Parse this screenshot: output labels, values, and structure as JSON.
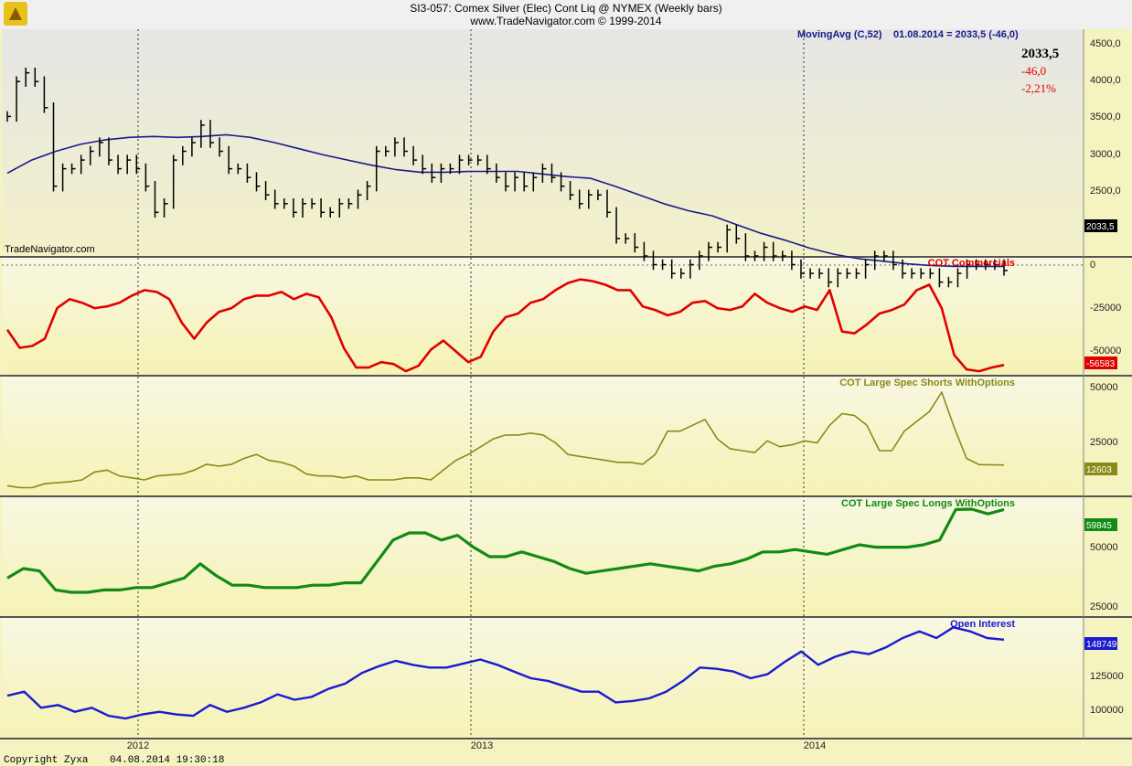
{
  "header": {
    "title": "SI3-057:  Comex Silver (Elec) Cont Liq @ NYMEX  (Weekly bars)",
    "subtitle": "www.TradeNavigator.com © 1999-2014",
    "watermark": "TradeNavigator.com",
    "footer_copyright": "Copyright Zyxa",
    "footer_timestamp": "04.08.2014 19:30:18"
  },
  "colors": {
    "price": "#000000",
    "ma": "#1a1a8c",
    "commercials": "#e00000",
    "shorts": "#8a8a1a",
    "longs": "#138a13",
    "oi": "#1a1ad0"
  },
  "chart_data": [
    {
      "type": "ohlc-bar",
      "panel": "price",
      "timeframe": "Weekly bars",
      "x_tick_labels": [
        "2012",
        "2013",
        "2014"
      ],
      "y_ticks": [
        "4500,0",
        "4000,0",
        "3500,0",
        "3000,0",
        "2500,0"
      ],
      "ylim": [
        2200,
        4800
      ],
      "overlay": {
        "name": "MovingAvg (C,52)",
        "readout": "01.08.2014 = 2033,5 (-46,0)",
        "values": [
          3150,
          3300,
          3400,
          3480,
          3530,
          3560,
          3570,
          3560,
          3570,
          3590,
          3560,
          3500,
          3430,
          3360,
          3300,
          3240,
          3190,
          3160,
          3160,
          3170,
          3170,
          3170,
          3140,
          3110,
          3090,
          3000,
          2900,
          2800,
          2720,
          2660,
          2560,
          2460,
          2380,
          2290,
          2220,
          2170,
          2140,
          2110,
          2090,
          2080,
          2080,
          2080
        ]
      },
      "values": [
        3800,
        4200,
        4300,
        4200,
        3900,
        3000,
        3200,
        3200,
        3300,
        3400,
        3500,
        3300,
        3200,
        3300,
        3200,
        3000,
        2700,
        2800,
        3300,
        3400,
        3500,
        3700,
        3500,
        3400,
        3200,
        3200,
        3100,
        3000,
        2900,
        2800,
        2800,
        2700,
        2800,
        2800,
        2700,
        2700,
        2800,
        2800,
        2900,
        3000,
        3400,
        3400,
        3500,
        3400,
        3300,
        3200,
        3100,
        3200,
        3200,
        3300,
        3300,
        3300,
        3200,
        3100,
        3000,
        3100,
        3000,
        3100,
        3200,
        3100,
        3000,
        2900,
        2800,
        2900,
        2900,
        2700,
        2400,
        2400,
        2300,
        2200,
        2100,
        2100,
        2000,
        2000,
        2100,
        2200,
        2300,
        2300,
        2500,
        2400,
        2200,
        2200,
        2300,
        2200,
        2200,
        2100,
        2000,
        2000,
        2000,
        1900,
        2000,
        2000,
        2000,
        2100,
        2200,
        2200,
        2100,
        2000,
        2000,
        2000,
        2000,
        1900,
        1900,
        2000,
        2100,
        2100,
        2100,
        2100,
        2033.5
      ],
      "last_value": "2033,5",
      "last_change": "-46,0",
      "last_change_pct": "-2,21%"
    },
    {
      "type": "line",
      "panel": "commercials",
      "series": [
        {
          "name": "COT Commercials",
          "values": [
            -37000,
            -47000,
            -46000,
            -42000,
            -25000,
            -20000,
            -22000,
            -25000,
            -24000,
            -22000,
            -18000,
            -15000,
            -16000,
            -20000,
            -33000,
            -42000,
            -33000,
            -27000,
            -25000,
            -20000,
            -18000,
            -18000,
            -16000,
            -20000,
            -17000,
            -19000,
            -30000,
            -47000,
            -58000,
            -58000,
            -55000,
            -56000,
            -60000,
            -57000,
            -48000,
            -43000,
            -49000,
            -55000,
            -52000,
            -38000,
            -30000,
            -28000,
            -22000,
            -20000,
            -15000,
            -11000,
            -9000,
            -10000,
            -12000,
            -15000,
            -15000,
            -24000,
            -26000,
            -29000,
            -27000,
            -22000,
            -21000,
            -25000,
            -26000,
            -24000,
            -17000,
            -22000,
            -25000,
            -27000,
            -24000,
            -26000,
            -15000,
            -38000,
            -39000,
            -34000,
            -28000,
            -26000,
            -23000,
            -15000,
            -12000,
            -25000,
            -51000,
            -59000,
            -60000,
            -58000,
            -56583
          ]
        }
      ],
      "y_ticks": [
        "0",
        "-25000",
        "-50000"
      ],
      "ylim": [
        -62000,
        3000
      ],
      "last_value": "-56583"
    },
    {
      "type": "line",
      "panel": "shorts",
      "series": [
        {
          "name": "COT Large Spec Shorts WithOptions",
          "values": [
            2000,
            1000,
            1000,
            3000,
            3500,
            4000,
            5000,
            9000,
            10000,
            7000,
            6000,
            5000,
            7000,
            7500,
            8000,
            10000,
            13000,
            12000,
            13000,
            16000,
            18000,
            15000,
            14000,
            12000,
            8000,
            7000,
            7000,
            6000,
            7000,
            5000,
            5000,
            5000,
            6000,
            6000,
            5000,
            10000,
            15000,
            18000,
            22000,
            26000,
            28000,
            28000,
            29000,
            28000,
            24000,
            18000,
            17000,
            16000,
            15000,
            14000,
            14000,
            13000,
            18000,
            30000,
            30000,
            33000,
            36000,
            26000,
            21000,
            20000,
            19000,
            25000,
            22000,
            23000,
            25000,
            24000,
            33000,
            39000,
            38000,
            33000,
            20000,
            20000,
            30000,
            35000,
            40000,
            50000,
            32000,
            16000,
            12800,
            12700,
            12603
          ]
        }
      ],
      "y_ticks": [
        "50000",
        "25000"
      ],
      "ylim": [
        -3000,
        58000
      ],
      "last_value": "12603"
    },
    {
      "type": "line",
      "panel": "longs",
      "series": [
        {
          "name": "COT Large Spec Longs WithOptions",
          "values": [
            31000,
            35000,
            34000,
            26000,
            25000,
            25000,
            26000,
            26000,
            27000,
            27000,
            29000,
            31000,
            37000,
            32000,
            28000,
            28000,
            27000,
            27000,
            27000,
            28000,
            28000,
            29000,
            29000,
            38000,
            47000,
            50000,
            50000,
            47000,
            49000,
            44000,
            40000,
            40000,
            42000,
            40000,
            38000,
            35000,
            33000,
            34000,
            35000,
            36000,
            37000,
            36000,
            35000,
            34000,
            36000,
            37000,
            39000,
            42000,
            42000,
            43000,
            42000,
            41000,
            43000,
            45000,
            44000,
            44000,
            44000,
            45000,
            47000,
            59845,
            60000,
            58000,
            59845
          ]
        }
      ],
      "y_ticks": [
        "50000",
        "25000"
      ],
      "ylim": [
        15000,
        65000
      ],
      "last_value": "59845"
    },
    {
      "type": "line",
      "panel": "open-interest",
      "series": [
        {
          "name": "Open Interest",
          "values": [
            107000,
            110000,
            98000,
            100000,
            95000,
            98000,
            92000,
            90000,
            93000,
            95000,
            93000,
            92000,
            100000,
            95000,
            98000,
            102000,
            108000,
            104000,
            106000,
            112000,
            116000,
            124000,
            129000,
            133000,
            130000,
            128000,
            128000,
            131000,
            134000,
            130000,
            125000,
            120000,
            118000,
            114000,
            110000,
            110000,
            102000,
            103000,
            105000,
            110000,
            118000,
            128000,
            127000,
            125000,
            120000,
            123000,
            132000,
            140000,
            130000,
            136000,
            140000,
            138000,
            143000,
            150000,
            155000,
            150000,
            158000,
            155000,
            150000,
            148749
          ]
        }
      ],
      "y_ticks": [
        "125000",
        "100000"
      ],
      "ylim": [
        75000,
        165000
      ],
      "last_value": "148749"
    }
  ]
}
